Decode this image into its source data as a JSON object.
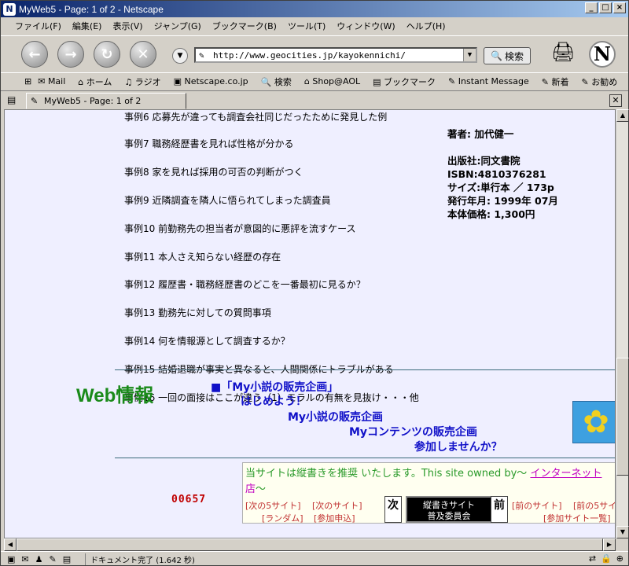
{
  "window": {
    "title": "MyWeb5 - Page: 1 of 2 - Netscape",
    "app_icon": "N"
  },
  "menu": [
    "ファイル(F)",
    "編集(E)",
    "表示(V)",
    "ジャンプ(G)",
    "ブックマーク(B)",
    "ツール(T)",
    "ウィンドウ(W)",
    "ヘルプ(H)"
  ],
  "toolbar": {
    "url": "http://www.geocities.jp/kayokennichi/",
    "search_label": "検索"
  },
  "personal_toolbar": [
    "Mail",
    "ホーム",
    "ラジオ",
    "Netscape.co.jp",
    "検索",
    "Shop@AOL",
    "ブックマーク",
    "Instant Message",
    "新着",
    "お勧め"
  ],
  "tab": {
    "label": "MyWeb5 - Page: 1 of 2"
  },
  "cases": [
    "事例6 応募先が違っても調査会社同じだったために発見した例",
    "事例7 職務経歴書を見れば性格が分かる",
    "事例8 家を見れば採用の可否の判断がつく",
    "事例9 近隣調査を隣人に悟られてしまった調査員",
    "事例10 前勤務先の担当者が意図的に悪評を流すケース",
    "事例11 本人さえ知らない経歴の存在",
    "事例12 履歴書・職務経歴書のどこを一番最初に見るか？",
    "事例13 勤務先に対しての質問事項",
    "事例14 何を情報源として調査するか？",
    "事例15 結婚退職が事実と異なると、人間関係にトラブルがある",
    "事例16 一回の面接はここが違う（1）モラルの有無を見抜け・・・他"
  ],
  "book": {
    "author": "著者: 加代健一",
    "publisher": "出版社:同文書院",
    "isbn": "ISBN:4810376281",
    "size": "サイズ:単行本 ／ 173p",
    "date": "発行年月: 1999年 07月",
    "price": "本体価格: 1,300円"
  },
  "web": {
    "heading": "Web情報",
    "banner": "■「My小説の販売企画」",
    "banner_sub": "はじめよう！",
    "link1": "My小説の販売企画",
    "link2": "Myコンテンツの販売企画",
    "link3": "参加しませんか？"
  },
  "ring": {
    "notice": "当サイトは縦書きを推奨 いたします。This site owned by～",
    "notice_link": "インターネット",
    "notice_cont": "店",
    "notice_tilde": "～",
    "next5": "[次の5サイト]",
    "next": "[次のサイト]",
    "random": "[ランダム]",
    "join": "[参加申込]",
    "next_char": "次",
    "prev_char": "前",
    "center1": "縦書きサイト",
    "center2": "普及委員会",
    "prev": "[前のサイト]",
    "prev5": "[前の5サイ",
    "list": "[参加サイト一覧]"
  },
  "counter": "00657",
  "status": {
    "message": "ドキュメント完了 (1.642 秒)"
  }
}
